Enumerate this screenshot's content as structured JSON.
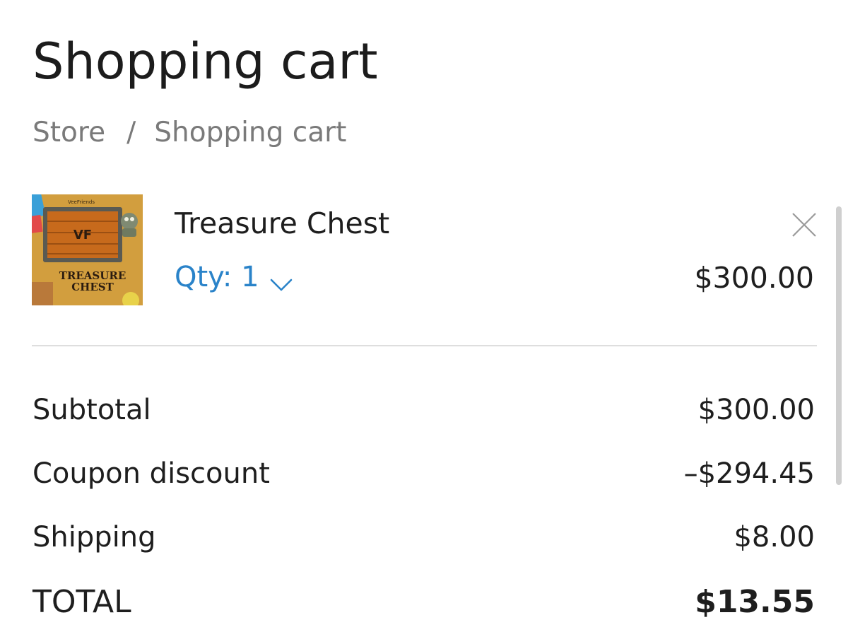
{
  "page": {
    "title": "Shopping cart"
  },
  "breadcrumb": {
    "items": [
      "Store",
      "Shopping cart"
    ],
    "separator": "/"
  },
  "cart": {
    "items": [
      {
        "name": "Treasure Chest",
        "qty_label": "Qty: 1",
        "price": "$300.00",
        "image": {
          "brand_text": "VeeFriends",
          "logo_text": "VF",
          "caption_line1": "TREASURE",
          "caption_line2": "CHEST"
        }
      }
    ]
  },
  "summary": {
    "subtotal_label": "Subtotal",
    "subtotal_value": "$300.00",
    "coupon_label": "Coupon discount",
    "coupon_value": "–$294.45",
    "shipping_label": "Shipping",
    "shipping_value": "$8.00",
    "total_label": "TOTAL",
    "total_value": "$13.55"
  },
  "colors": {
    "accent": "#2a83c9",
    "text": "#1e1e1e",
    "muted": "#7a7a7a",
    "divider": "#dedede"
  },
  "icons": {
    "remove": "close-icon",
    "qty_dropdown": "chevron-down-icon"
  }
}
